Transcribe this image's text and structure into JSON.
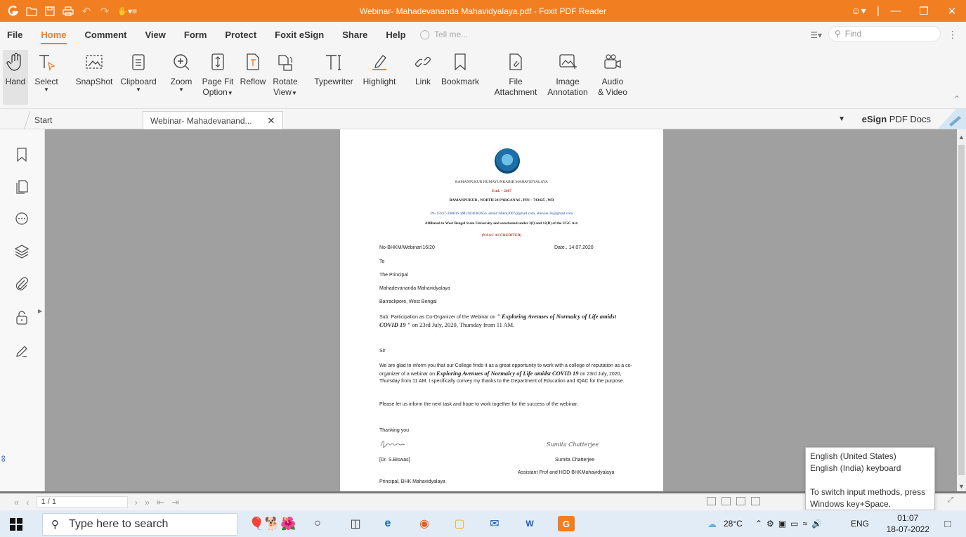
{
  "window": {
    "title": "Webinar- Mahadevananda Mahavidyalaya.pdf - Foxit PDF Reader"
  },
  "menu": {
    "items": [
      "File",
      "Home",
      "Comment",
      "View",
      "Form",
      "Protect",
      "Foxit eSign",
      "Share",
      "Help"
    ],
    "active": "Home",
    "tell_me_placeholder": "Tell me...",
    "find_placeholder": "Find"
  },
  "ribbon": {
    "hand": "Hand",
    "select": "Select",
    "snapshot": "SnapShot",
    "clipboard": "Clipboard",
    "zoom": "Zoom",
    "page_fit_1": "Page Fit",
    "page_fit_2": "Option",
    "reflow": "Reflow",
    "rotate_1": "Rotate",
    "rotate_2": "View",
    "typewriter": "Typewriter",
    "highlight": "Highlight",
    "link": "Link",
    "bookmark": "Bookmark",
    "file_attach_1": "File",
    "file_attach_2": "Attachment",
    "image_annot_1": "Image",
    "image_annot_2": "Annotation",
    "audio_1": "Audio",
    "audio_2": "& Video"
  },
  "tabs": {
    "start": "Start",
    "doc": "Webinar- Mahadevanand...",
    "esign_bold": "eSign",
    "esign_rest": " PDF Docs"
  },
  "document": {
    "college": "BAMANPUKUR HUMAYUNKABIR MAHAVIDYALAYA",
    "estd": "Estd. – 2007",
    "address": "BAMANPUKUR , NORTH 24 PARGANAS , PIN – 743425 , WB",
    "contact": "Ph- 03217-260816 /(M) 9830362656 .email :bhkm2007@gmail.com, sbiswas.3k@gmail.com",
    "affiliation": "Affiliated to West Bengal State University and sanctioned under 2(f) and 12(B) of the UGC Act.",
    "naac": "(NAAC ACCREDITED)",
    "ref_no": "No-BHKM/Webinar/16/20",
    "date": "Date.. 14.07.2020",
    "to": "To",
    "addressee": "The Principal",
    "addressee_college": "Mahadevananda  Mahavidyalaya",
    "addressee_place": "Barrackpore, West Bengal",
    "subject_prefix": "Sub: Participation as Co-Organizer of the Webinar  on ",
    "subject_title": "\" Exploring Avenues of Normalcy of Life amidst COVID 19 \"",
    "subject_suffix": " on 23rd July, 2020, Thursday from 11 AM.",
    "salutation": "Sir",
    "body1_prefix": "We are glad to inform you that our College finds it as a great opportunity to work with a college of reputation as a co-organizer of a webinar on ",
    "body1_title": "Exploring Avenues of Normalcy of Life amidst COVID 19",
    "body1_suffix": " on 23rd July, 2020, Thursday from 11 AM.  I specifically convey my thanks to the Department of Education  and IQAC for the purpose.",
    "body2": "Please let us inform the next task and hope to work together for the success of the webinar.",
    "closing": "Thanking you",
    "signer1": "[Dr. S.Biswas]",
    "signer1_title": "Principal, BHK Mahavidyalaya",
    "signer2": "Sumita Chatterjee",
    "signer2_title": "Assistant Prof and HOD BHKMahavidyalaya",
    "signature2": "Sumita Chatterjee"
  },
  "pagenav": {
    "page_value": "1 / 1"
  },
  "taskbar": {
    "search_placeholder": "Type here to search",
    "weather": "28°C",
    "language": "ENG",
    "time": "01:07",
    "date": "18-07-2022"
  },
  "ime_popup": {
    "line1": "English (United States)",
    "line2": "English (India) keyboard",
    "line3": "To switch input methods, press",
    "line4": "Windows key+Space."
  },
  "colors": {
    "accent": "#f27e22",
    "canvas": "#a0a0a0"
  }
}
